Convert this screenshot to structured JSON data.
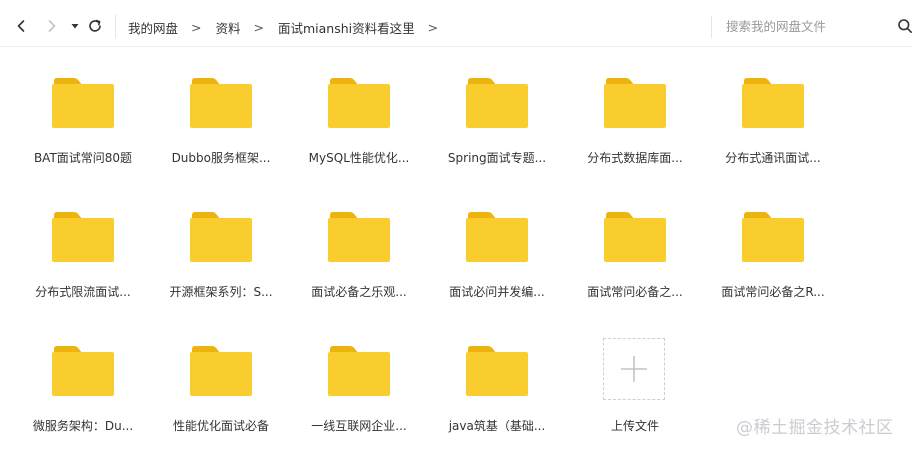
{
  "toolbar": {
    "back_icon": "chevron-left-icon",
    "forward_icon": "chevron-right-icon",
    "history_icon": "caret-down-icon",
    "refresh_icon": "refresh-icon"
  },
  "breadcrumb": {
    "items": [
      "我的网盘",
      "资料",
      "面试mianshi资料看这里"
    ],
    "separator": ">"
  },
  "search": {
    "placeholder": "搜索我的网盘文件",
    "value": "",
    "icon": "search-icon"
  },
  "files": [
    {
      "name": "BAT面试常问80题",
      "type": "folder"
    },
    {
      "name": "Dubbo服务框架...",
      "type": "folder"
    },
    {
      "name": "MySQL性能优化...",
      "type": "folder"
    },
    {
      "name": "Spring面试专题...",
      "type": "folder"
    },
    {
      "name": "分布式数据库面...",
      "type": "folder"
    },
    {
      "name": "分布式通讯面试...",
      "type": "folder"
    },
    {
      "name": "分布式限流面试...",
      "type": "folder"
    },
    {
      "name": "开源框架系列：S...",
      "type": "folder"
    },
    {
      "name": "面试必备之乐观...",
      "type": "folder"
    },
    {
      "name": "面试必问并发编...",
      "type": "folder"
    },
    {
      "name": "面试常问必备之...",
      "type": "folder"
    },
    {
      "name": "面试常问必备之R...",
      "type": "folder"
    },
    {
      "name": "微服务架构：Du...",
      "type": "folder"
    },
    {
      "name": "性能优化面试必备",
      "type": "folder"
    },
    {
      "name": "一线互联网企业...",
      "type": "folder"
    },
    {
      "name": "java筑基（基础...",
      "type": "folder"
    }
  ],
  "upload": {
    "label": "上传文件",
    "icon": "plus-icon"
  },
  "colors": {
    "folder_body": "#F9CD2D",
    "folder_tab": "#EDB40F",
    "text": "#333333",
    "placeholder": "#999999"
  },
  "watermark": "@稀土掘金技术社区"
}
